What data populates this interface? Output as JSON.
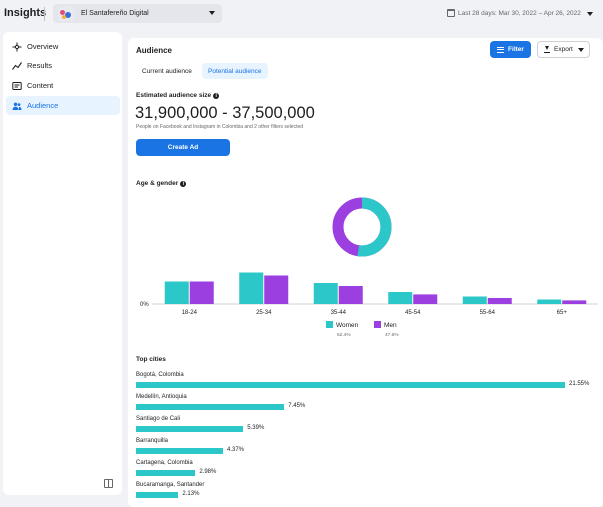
{
  "header": {
    "app_title": "Insights",
    "page_name": "El Santafereño Digital",
    "date_range": "Last 28 days: Mar 30, 2022 – Apr 26, 2022"
  },
  "sidebar": {
    "items": [
      {
        "label": "Overview",
        "icon": "overview-icon",
        "active": false
      },
      {
        "label": "Results",
        "icon": "results-icon",
        "active": false
      },
      {
        "label": "Content",
        "icon": "content-icon",
        "active": false
      },
      {
        "label": "Audience",
        "icon": "audience-icon",
        "active": true
      }
    ]
  },
  "main": {
    "title": "Audience",
    "filter_label": "Filter",
    "export_label": "Export",
    "tabs": [
      {
        "label": "Current audience",
        "active": false
      },
      {
        "label": "Potential audience",
        "active": true
      }
    ],
    "size_label": "Estimated audience size",
    "size_value": "31,900,000 - 37,500,000",
    "size_desc": "People on Facebook and Instagram in Colombia and 2 other filters selected",
    "create_ad_label": "Create Ad",
    "age_gender_label": "Age & gender",
    "top_cities_label": "Top cities"
  },
  "colors": {
    "accent": "#1b74e4",
    "women": "#2cc7c9",
    "men": "#9b3fe0"
  },
  "chart_data": {
    "type": "bar",
    "categories": [
      "18-24",
      "25-34",
      "35-44",
      "45-54",
      "55-64",
      "65+"
    ],
    "series": [
      {
        "name": "Women",
        "values": [
          7.5,
          10.5,
          7.0,
          4.0,
          2.5,
          1.5
        ]
      },
      {
        "name": "Men",
        "values": [
          7.5,
          9.5,
          6.0,
          3.2,
          2.0,
          1.2
        ]
      }
    ],
    "zero_label": "0%",
    "donut": {
      "women_pct": 52.4,
      "men_pct": 47.6
    },
    "legend": [
      {
        "name": "Women",
        "pct": "52.4%"
      },
      {
        "name": "Men",
        "pct": "47.6%"
      }
    ],
    "ylim": [
      0,
      12
    ],
    "grid": false,
    "legend_position": "bottom"
  },
  "top_cities": [
    {
      "name": "Bogotá, Colombia",
      "pct": 21.55,
      "label": "21.55%"
    },
    {
      "name": "Medellín, Antioquia",
      "pct": 7.45,
      "label": "7.45%"
    },
    {
      "name": "Santiago de Cali",
      "pct": 5.39,
      "label": "5.39%"
    },
    {
      "name": "Barranquilla",
      "pct": 4.37,
      "label": "4.37%"
    },
    {
      "name": "Cartagena, Colombia",
      "pct": 2.98,
      "label": "2.98%"
    },
    {
      "name": "Bucaramanga, Santander",
      "pct": 2.13,
      "label": "2.13%"
    }
  ]
}
